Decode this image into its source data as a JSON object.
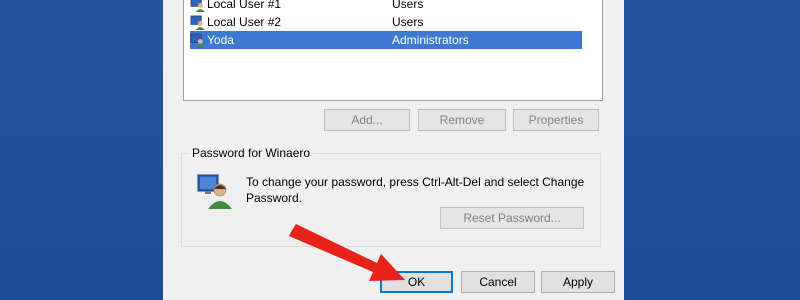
{
  "users": {
    "rows": [
      {
        "name": "Local User #1",
        "group": "Users"
      },
      {
        "name": "Local User #2",
        "group": "Users"
      },
      {
        "name": "Yoda",
        "group": "Administrators"
      }
    ],
    "selected_index": 2,
    "add_label": "Add...",
    "remove_label": "Remove",
    "properties_label": "Properties"
  },
  "password": {
    "legend": "Password for Winaero",
    "message": "To change your password, press Ctrl-Alt-Del and select Change Password.",
    "reset_label": "Reset Password..."
  },
  "footer": {
    "ok_label": "OK",
    "cancel_label": "Cancel",
    "apply_label": "Apply"
  },
  "colors": {
    "selection": "#3d78d1",
    "arrow": "#e8231b",
    "desktop": "#1f4d98"
  },
  "icons": {
    "user": "user-icon",
    "arrow": "red-arrow-annotation"
  }
}
